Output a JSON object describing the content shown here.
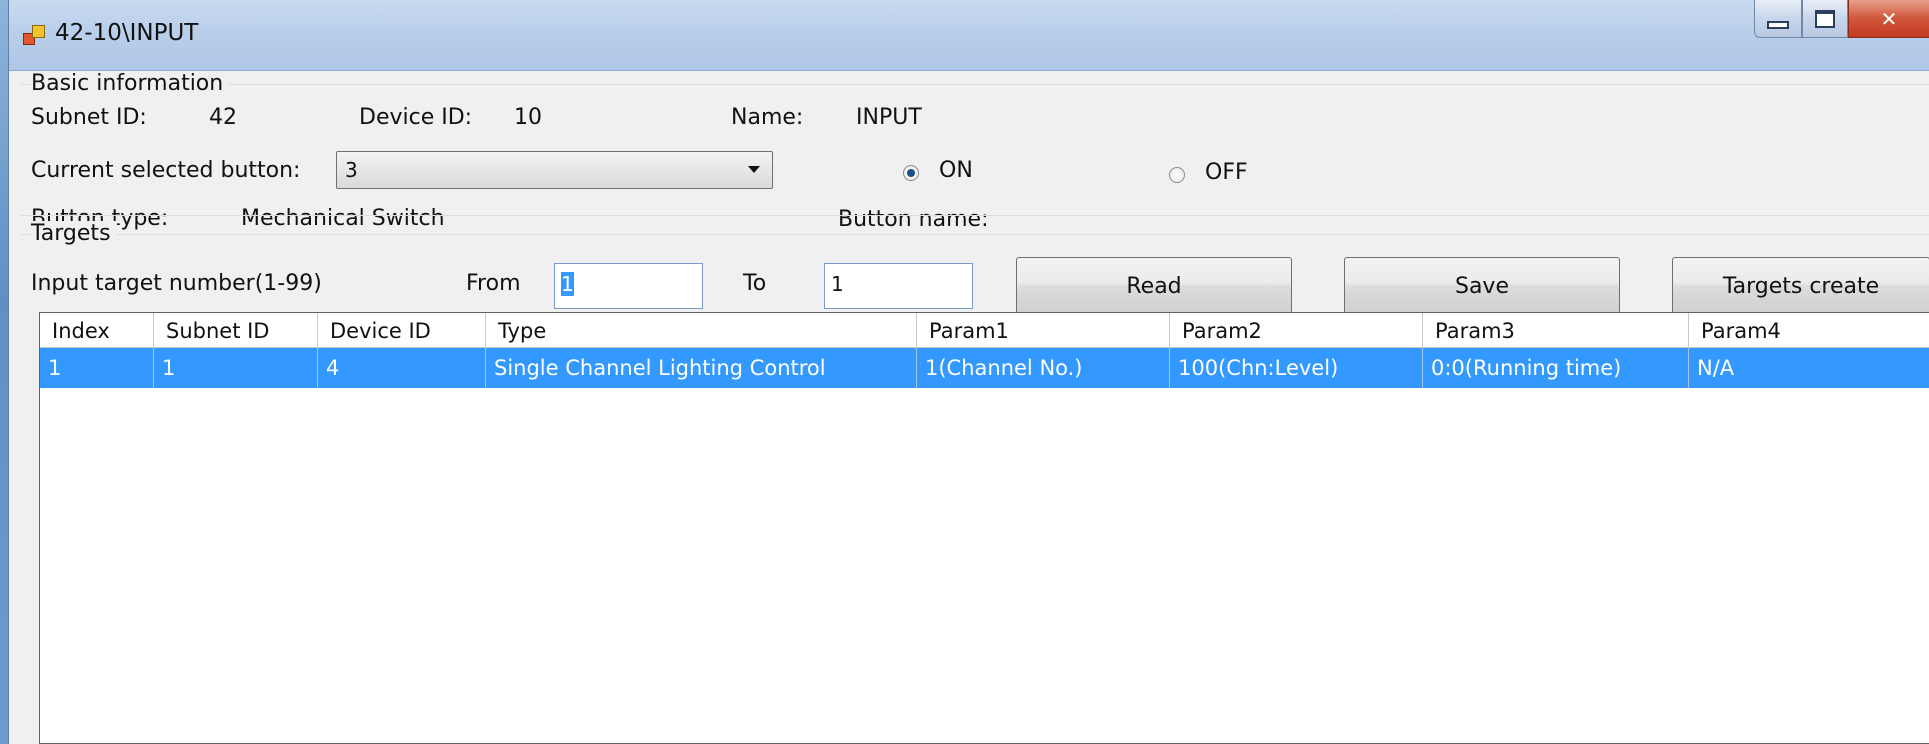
{
  "window": {
    "title": "42-10\\INPUT"
  },
  "basic": {
    "group_title": "Basic information",
    "subnet_label": "Subnet ID:",
    "subnet_value": "42",
    "device_label": "Device ID:",
    "device_value": "10",
    "name_label": "Name:",
    "name_value": "INPUT",
    "current_button_label": "Current selected button:",
    "current_button_value": "3",
    "on_label": "ON",
    "off_label": "OFF",
    "on_selected": true,
    "button_type_label": "Button type:",
    "button_type_value": "Mechanical Switch",
    "button_name_label": "Button name:"
  },
  "targets": {
    "group_title": "Targets",
    "input_label": "Input target number(1-99)",
    "from_label": "From",
    "from_value": "1",
    "to_label": "To",
    "to_value": "1",
    "read_label": "Read",
    "save_label": "Save",
    "create_label": "Targets create"
  },
  "table": {
    "columns": [
      "Index",
      "Subnet ID",
      "Device ID",
      "Type",
      "Param1",
      "Param2",
      "Param3",
      "Param4"
    ],
    "rows": [
      [
        "1",
        "1",
        "4",
        "Single Channel Lighting Control",
        "1(Channel No.)",
        "100(Chn:Level)",
        "0:0(Running time)",
        "N/A"
      ]
    ],
    "selected_row": 0
  },
  "colors": {
    "selection": "#3399ff",
    "titlebar": "#b9cfea",
    "close": "#c23b22"
  }
}
